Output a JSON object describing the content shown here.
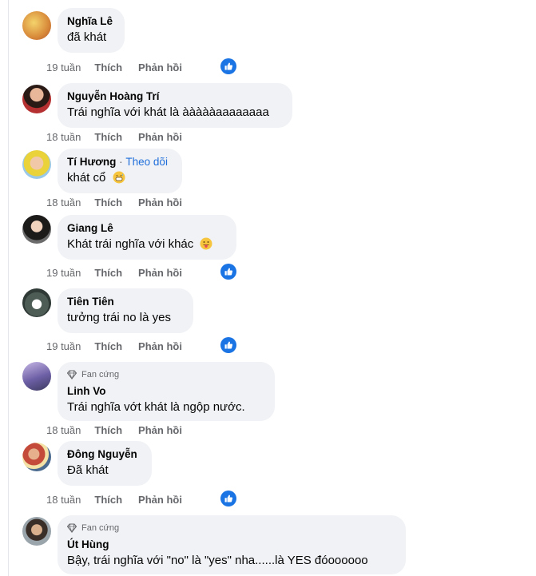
{
  "comments": [
    {
      "author": "Nghĩa Lê",
      "text": "đã khát",
      "time": "19 tuần",
      "like": "Thích",
      "reply": "Phản hồi",
      "liked": true
    },
    {
      "author": "Nguyễn Hoàng Trí",
      "text": "Trái nghĩa với khát là àààààaaaaaaaa",
      "time": "18 tuần",
      "like": "Thích",
      "reply": "Phản hồi",
      "liked": false
    },
    {
      "author": "Tí Hương",
      "follow": "Theo dõi",
      "separator": "·",
      "text": "khát cổ",
      "time": "18 tuần",
      "like": "Thích",
      "reply": "Phản hồi",
      "emoji": "grin-sweat-emoji",
      "liked": false
    },
    {
      "author": "Giang Lê",
      "text": "Khát trái nghĩa với khác",
      "time": "19 tuần",
      "like": "Thích",
      "reply": "Phản hồi",
      "emoji": "tongue-emoji",
      "liked": true
    },
    {
      "author": "Tiên Tiên",
      "text": "tưởng trái no là yes",
      "time": "19 tuần",
      "like": "Thích",
      "reply": "Phản hồi",
      "liked": true
    },
    {
      "author": "Linh Vo",
      "badge": "Fan cứng",
      "text": "Trái nghĩa vớt khát là ngộp nước.",
      "time": "18 tuần",
      "like": "Thích",
      "reply": "Phản hồi",
      "liked": false
    },
    {
      "author": "Đông Nguyễn",
      "text": "Đã khát",
      "time": "18 tuần",
      "like": "Thích",
      "reply": "Phản hồi",
      "liked": true
    },
    {
      "author": "Út Hùng",
      "badge": "Fan cứng",
      "text": "Bậy, trái nghĩa với \"no\" là \"yes\" nha......là YES đóoooooo",
      "liked": false
    }
  ],
  "colors": {
    "bubble": "#f0f2f5",
    "like_blue": "#1b74e4",
    "link_blue": "#216fdb",
    "meta_gray": "#65676b"
  }
}
